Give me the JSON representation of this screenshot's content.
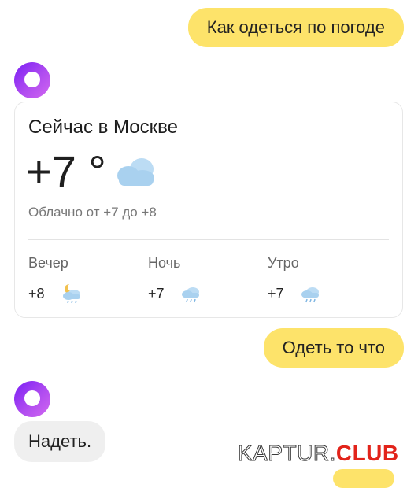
{
  "chat": {
    "user_message_1": "Как одеться по погоде",
    "user_message_2": "Одеть то что",
    "bot_reply": "Надеть."
  },
  "weather_card": {
    "title": "Сейчас в Москве",
    "temperature": "+7 °",
    "condition_icon": "cloud-icon",
    "description": "Облачно от +7 до +8",
    "forecast": [
      {
        "label": "Вечер",
        "temp": "+8",
        "icon": "partly-cloudy-night-rain-icon"
      },
      {
        "label": "Ночь",
        "temp": "+7",
        "icon": "cloud-rain-icon"
      },
      {
        "label": "Утро",
        "temp": "+7",
        "icon": "cloud-rain-icon"
      }
    ]
  },
  "watermark": {
    "part1": "KAPTUR.",
    "part2": "CLUB"
  },
  "colors": {
    "user_bubble": "#fde36a",
    "bot_bubble": "#efefef",
    "avatar_gradient_start": "#7a1ef5",
    "avatar_gradient_end": "#d167f0",
    "cloud": "#a9d1ef",
    "watermark_accent": "#e2231a"
  }
}
